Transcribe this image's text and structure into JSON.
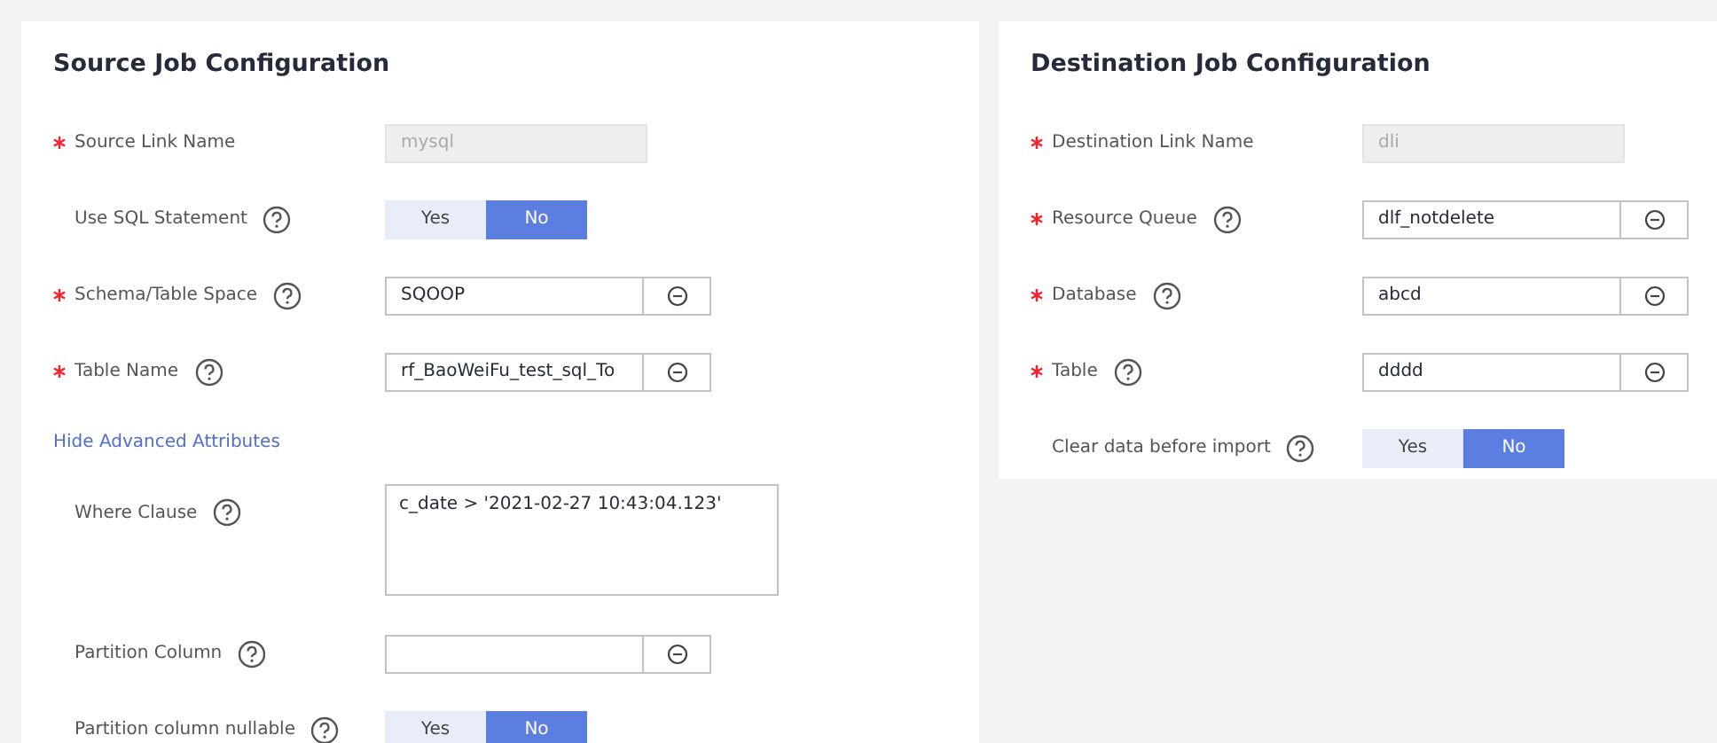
{
  "source": {
    "title": "Source Job Configuration",
    "fields": [
      {
        "kind": "readonly",
        "label": "Source Link Name",
        "required": true,
        "help": false,
        "value": "mysql"
      },
      {
        "kind": "toggle",
        "label": "Use SQL Statement",
        "required": false,
        "help": true,
        "options": [
          {
            "label": "Yes",
            "selected": false
          },
          {
            "label": "No",
            "selected": true
          }
        ]
      },
      {
        "kind": "select",
        "label": "Schema/Table Space",
        "required": true,
        "help": true,
        "value": "SQOOP"
      },
      {
        "kind": "select",
        "label": "Table Name",
        "required": true,
        "help": true,
        "value": "rf_BaoWeiFu_test_sql_To"
      },
      {
        "kind": "link",
        "label": "Hide Advanced Attributes"
      },
      {
        "kind": "textarea",
        "label": "Where Clause",
        "required": false,
        "help": true,
        "value": "c_date > '2021-02-27 10:43:04.123'"
      },
      {
        "kind": "select",
        "label": "Partition Column",
        "required": false,
        "help": true
      },
      {
        "kind": "toggle",
        "label": "Partition column nullable",
        "required": false,
        "help": true,
        "options": [
          {
            "label": "Yes",
            "selected": false
          },
          {
            "label": "No",
            "selected": true
          }
        ]
      }
    ]
  },
  "destination": {
    "title": "Destination Job Configuration",
    "fields": [
      {
        "kind": "readonly",
        "label": "Destination Link Name",
        "required": true,
        "help": false,
        "value": "dli"
      },
      {
        "kind": "select",
        "label": "Resource Queue",
        "required": true,
        "help": true,
        "value": "dlf_notdelete"
      },
      {
        "kind": "select",
        "label": "Database",
        "required": true,
        "help": true,
        "value": "abcd"
      },
      {
        "kind": "select",
        "label": "Table",
        "required": true,
        "help": true,
        "value": "dddd"
      },
      {
        "kind": "toggle",
        "label": "Clear data before import",
        "required": false,
        "help": true,
        "options": [
          {
            "label": "Yes",
            "selected": false
          },
          {
            "label": "No",
            "selected": true
          }
        ]
      }
    ]
  }
}
